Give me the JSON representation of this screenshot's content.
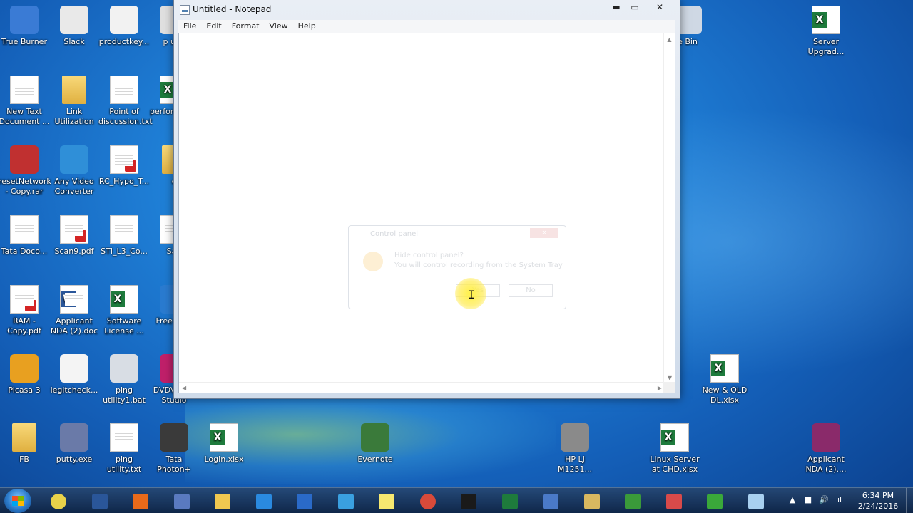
{
  "desktop": {
    "icons": [
      {
        "label": "True Burner",
        "kind": "app",
        "color": "#3a7bd5"
      },
      {
        "label": "Slack",
        "kind": "app",
        "color": "#e9e9e9"
      },
      {
        "label": "productkey...",
        "kind": "app",
        "color": "#f2f2f2"
      },
      {
        "label": "New Text Document ...",
        "kind": "doc"
      },
      {
        "label": "Link Utilization",
        "kind": "folder"
      },
      {
        "label": "Point of discussion.txt",
        "kind": "doc"
      },
      {
        "label": "perfor testin",
        "kind": "xl"
      },
      {
        "label": "resetNetwork - Copy.rar",
        "kind": "app",
        "color": "#c03030"
      },
      {
        "label": "Any Video Converter",
        "kind": "app",
        "color": "#2f8fd8"
      },
      {
        "label": "RC_Hypo_T...",
        "kind": "pdf"
      },
      {
        "label": "Tata Doco...",
        "kind": "doc"
      },
      {
        "label": "Scan9.pdf",
        "kind": "pdf"
      },
      {
        "label": "STI_L3_Co...",
        "kind": "doc"
      },
      {
        "label": "Sag",
        "kind": "doc"
      },
      {
        "label": "RAM - Copy.pdf",
        "kind": "pdf"
      },
      {
        "label": "Applicant NDA (2).doc",
        "kind": "word"
      },
      {
        "label": "Software License ...",
        "kind": "xl"
      },
      {
        "label": "Free Vide",
        "kind": "app",
        "color": "#2a7bd0"
      },
      {
        "label": "Picasa 3",
        "kind": "app",
        "color": "#e8a020"
      },
      {
        "label": "legitcheck...",
        "kind": "app",
        "color": "#f4f4f4"
      },
      {
        "label": "ping utility1.bat",
        "kind": "app",
        "color": "#d8dde4"
      },
      {
        "label": "DVDV Free Studio",
        "kind": "app",
        "color": "#c0206a"
      },
      {
        "label": "FB",
        "kind": "folder"
      },
      {
        "label": "putty.exe",
        "kind": "app",
        "color": "#6a7aa8"
      },
      {
        "label": "ping utility.txt",
        "kind": "doc"
      },
      {
        "label": "Tata Photon+",
        "kind": "app",
        "color": "#3a3a3a"
      },
      {
        "label": "Login.xlsx",
        "kind": "xl"
      },
      {
        "label": "Evernote",
        "kind": "app",
        "color": "#3a7a3a"
      },
      {
        "label": "HP LJ M1251...",
        "kind": "app",
        "color": "#8a8a8a"
      },
      {
        "label": "Linux Server at CHD.xlsx",
        "kind": "xl"
      },
      {
        "label": "Applicant NDA (2)....",
        "kind": "app",
        "color": "#8a2a6a"
      },
      {
        "label": "New & OLD DL.xlsx",
        "kind": "xl"
      },
      {
        "label": "Server Upgrad...",
        "kind": "xl"
      },
      {
        "label": "e Bin",
        "kind": "app",
        "color": "#cfd8e4"
      },
      {
        "label": "p utili",
        "kind": "app",
        "color": "#e0e0e0"
      },
      {
        "label": "e",
        "kind": "folder"
      }
    ]
  },
  "notepad": {
    "title": "Untitled - Notepad",
    "menu": [
      "File",
      "Edit",
      "Format",
      "View",
      "Help"
    ],
    "minimize": "▬",
    "maximize": "▭",
    "close": "✕",
    "scroll_up": "▲",
    "scroll_down": "▼",
    "scroll_left": "◀",
    "scroll_right": "▶",
    "content": ""
  },
  "ghost_dialog": {
    "title": "Control panel",
    "question": "Hide control panel?",
    "subtext": "You will control recording from the System Tray",
    "yes": "Yes",
    "no": "No"
  },
  "cursor": {
    "glyph": "I"
  },
  "taskbar": {
    "items": [
      {
        "name": "chrome",
        "color": "#e8d24a"
      },
      {
        "name": "word",
        "color": "#2a5699"
      },
      {
        "name": "firefox",
        "color": "#e86a1a"
      },
      {
        "name": "network-app",
        "color": "#5a7ac0"
      },
      {
        "name": "explorer",
        "color": "#f0c850"
      },
      {
        "name": "internet-explorer",
        "color": "#2a8ae0"
      },
      {
        "name": "outlook",
        "color": "#2a6ac8"
      },
      {
        "name": "snipping-tool",
        "color": "#3aa0e0"
      },
      {
        "name": "sticky-notes",
        "color": "#f6e870"
      },
      {
        "name": "chrome-2",
        "color": "#d84a3a"
      },
      {
        "name": "cmd",
        "color": "#1a1a1a"
      },
      {
        "name": "excel",
        "color": "#1e7b3c"
      },
      {
        "name": "remote-desktop",
        "color": "#4a7ac8"
      },
      {
        "name": "paint",
        "color": "#d8b860"
      },
      {
        "name": "task-manager",
        "color": "#3a9a3a"
      },
      {
        "name": "snip",
        "color": "#d84a4a"
      },
      {
        "name": "hangouts",
        "color": "#3aa83a"
      },
      {
        "name": "notepad",
        "color": "#a8d0f0"
      }
    ],
    "tray": {
      "arrow": "▲",
      "stop": "■",
      "volume": "🔊",
      "network": "ıl",
      "time": "6:34 PM",
      "date": "2/24/2016"
    }
  }
}
